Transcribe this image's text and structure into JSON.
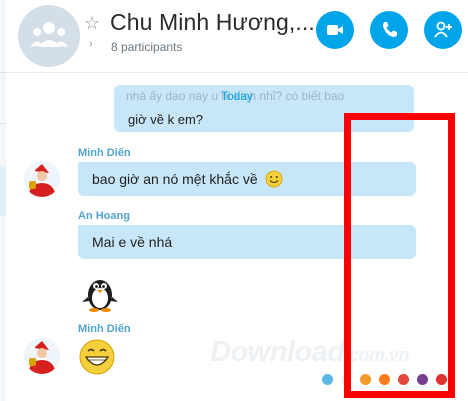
{
  "header": {
    "title": "Chu Minh Hương,...",
    "participants": "8 participants",
    "buttons": {
      "video_icon": "video-camera-icon",
      "call_icon": "phone-icon",
      "add_icon": "add-person-icon"
    }
  },
  "chat": {
    "date_separator": "Today",
    "messages": [
      {
        "sender": "",
        "text": "giờ về k em?",
        "partial_text": "nhà ấy dao nay          u hi kinh nhỉ? có biết bao"
      },
      {
        "sender": "Minh Diến",
        "text": "bao giờ an nó mệt khắc về",
        "emoji": "smile"
      },
      {
        "sender": "An Hoang",
        "text": "Mai e về nhá"
      },
      {
        "sender": "",
        "sticker": "penguin"
      },
      {
        "sender": "Minh Diến",
        "emoji": "big-grin"
      }
    ]
  },
  "watermark": {
    "text": "Download",
    "suffix": ".com.vn"
  },
  "colors": {
    "accent": "#00a4e8",
    "bubble": "#c7e6f8",
    "sender": "#4fa4cf",
    "annotation": "#ff0000"
  }
}
